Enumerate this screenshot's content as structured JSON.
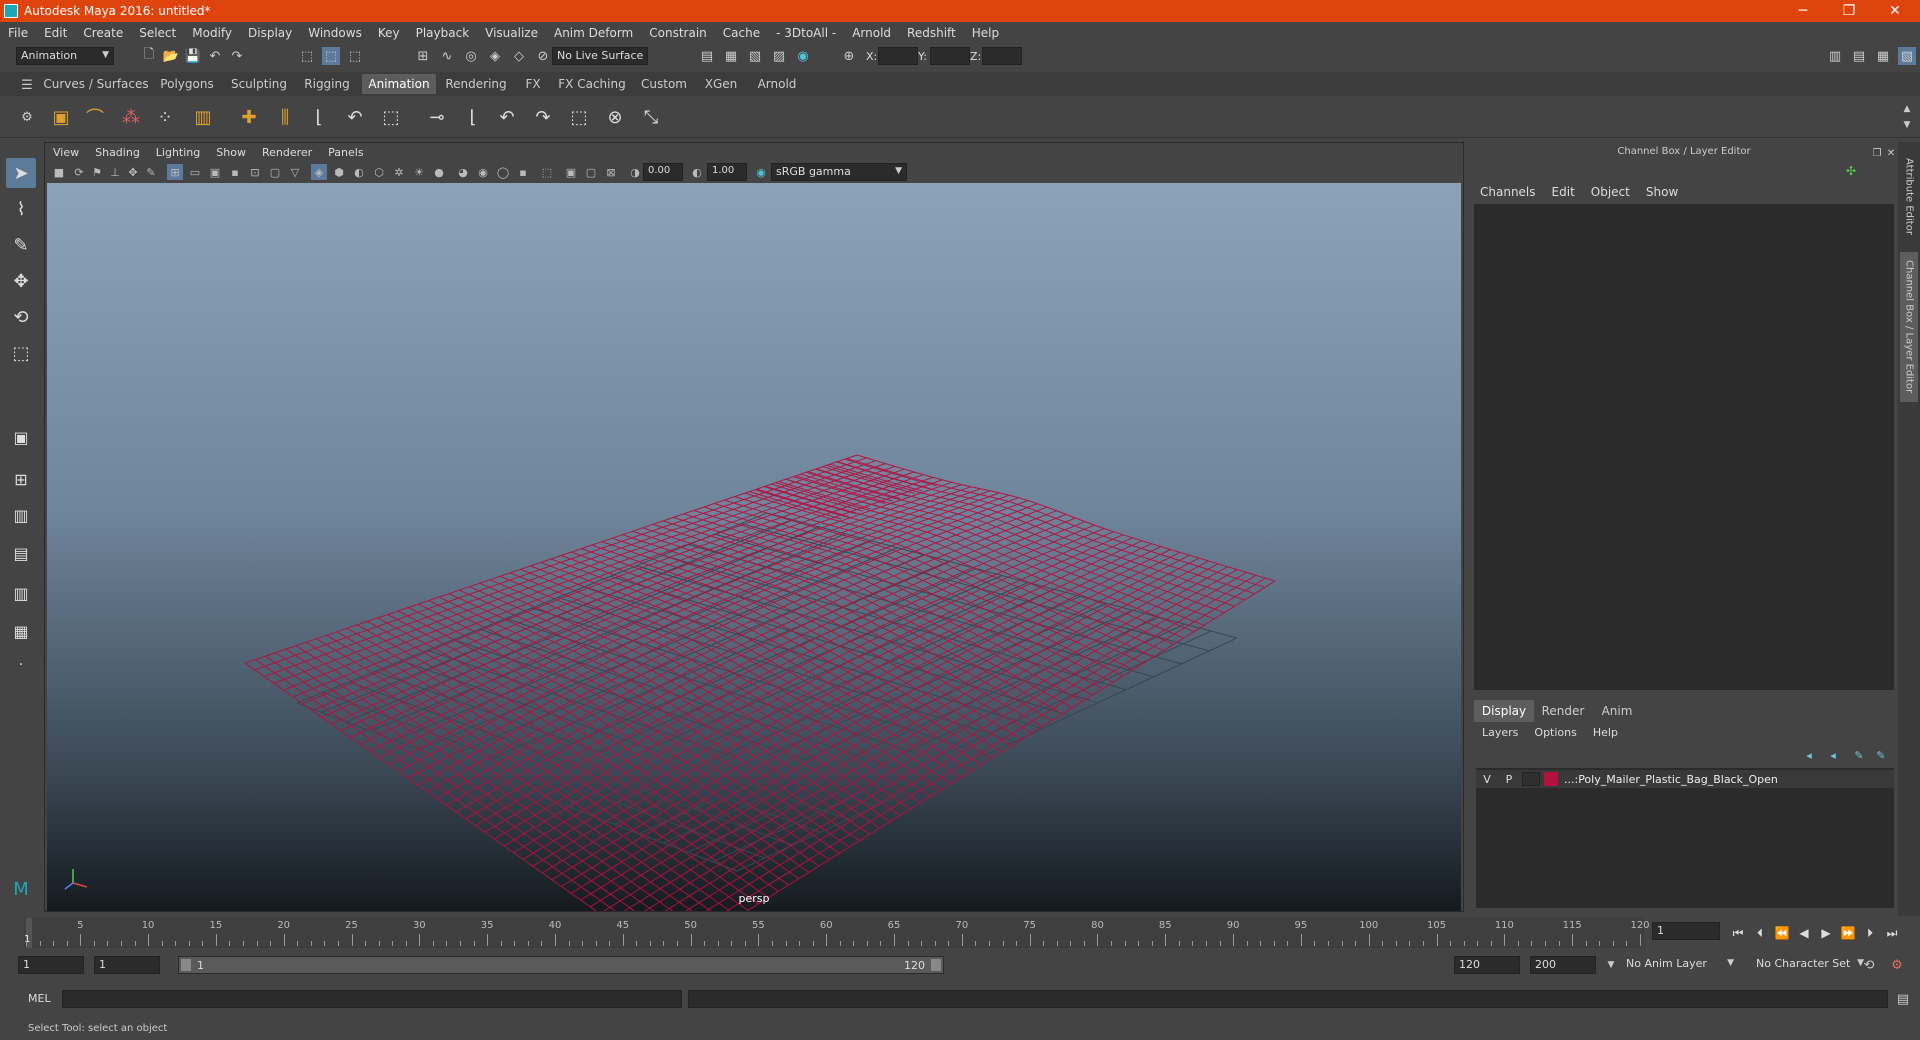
{
  "window": {
    "title": "Autodesk Maya 2016: untitled*",
    "minimize": "─",
    "maximize": "❐",
    "close": "✕"
  },
  "menubar": [
    "File",
    "Edit",
    "Create",
    "Select",
    "Modify",
    "Display",
    "Windows",
    "Key",
    "Playback",
    "Visualize",
    "Anim Deform",
    "Constrain",
    "Cache",
    "- 3DtoAll -",
    "Arnold",
    "Redshift",
    "Help"
  ],
  "statusline": {
    "menuset": "Animation",
    "live_surface": "No Live Surface",
    "x_label": "X:",
    "y_label": "Y:",
    "z_label": "Z:"
  },
  "shelf_tabs": [
    "Curves / Surfaces",
    "Polygons",
    "Sculpting",
    "Rigging",
    "Animation",
    "Rendering",
    "FX",
    "FX Caching",
    "Custom",
    "XGen",
    "Arnold"
  ],
  "shelf_active": "Animation",
  "panel": {
    "menu": [
      "View",
      "Shading",
      "Lighting",
      "Show",
      "Renderer",
      "Panels"
    ],
    "exposure": "0.00",
    "gamma": "1.00",
    "color_space": "sRGB gamma",
    "camera_label": "persp"
  },
  "right_panel": {
    "title": "Channel Box / Layer Editor",
    "cb_menu": [
      "Channels",
      "Edit",
      "Object",
      "Show"
    ],
    "layer_tabs": [
      "Display",
      "Render",
      "Anim"
    ],
    "layer_menu": [
      "Layers",
      "Options",
      "Help"
    ],
    "layer": {
      "v": "V",
      "p": "P",
      "name": "...:Poly_Mailer_Plastic_Bag_Black_Open",
      "color": "#b5103e"
    }
  },
  "side_tabs": [
    "Attribute Editor",
    "Channel Box / Layer Editor"
  ],
  "timeline": {
    "ticks": [
      "5",
      "10",
      "15",
      "20",
      "25",
      "30",
      "35",
      "40",
      "45",
      "50",
      "55",
      "60",
      "65",
      "70",
      "75",
      "80",
      "85",
      "90",
      "95",
      "100",
      "105",
      "110",
      "115",
      "120"
    ],
    "current_frame": "1",
    "current_frame_field": "1"
  },
  "range": {
    "start": "1",
    "playback_start": "1",
    "slider_start": "1",
    "slider_end": "120",
    "playback_end": "120",
    "end": "200",
    "anim_layer": "No Anim Layer",
    "character_set": "No Character Set"
  },
  "command_line": {
    "lang": "MEL"
  },
  "help_line": "Select Tool: select an object",
  "colors": {
    "titlebar": "#e0440e",
    "mesh_wire": "#b5103e",
    "accent_tab": "#5d5d5d"
  }
}
